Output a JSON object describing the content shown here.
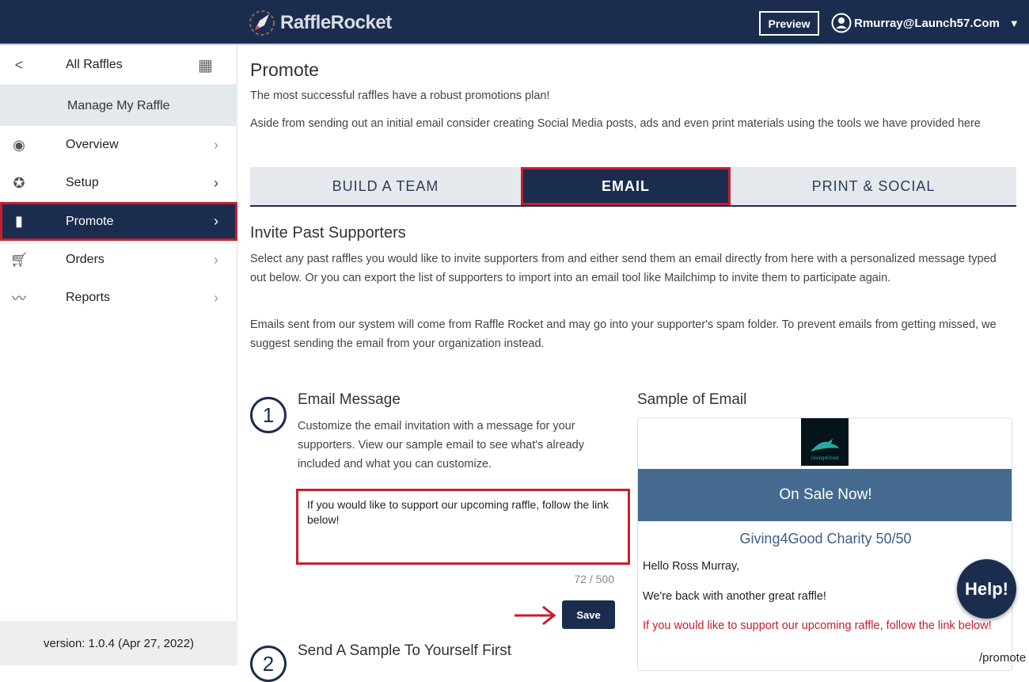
{
  "header": {
    "logo": "RaffleRocket",
    "preview_label": "Preview",
    "user_email": "Rmurray@Launch57.Com"
  },
  "sidebar": {
    "back_label": "All Raffles",
    "section": "Manage My Raffle",
    "items": [
      {
        "label": "Overview",
        "icon": "eye-icon"
      },
      {
        "label": "Setup",
        "icon": "lifebuoy-icon"
      },
      {
        "label": "Promote",
        "icon": "bar-chart-icon",
        "active": true
      },
      {
        "label": "Orders",
        "icon": "cart-icon"
      },
      {
        "label": "Reports",
        "icon": "trend-icon"
      }
    ],
    "version": "version: 1.0.4 (Apr 27, 2022)"
  },
  "page": {
    "title": "Promote",
    "intro1": "The most successful raffles have a robust promotions plan!",
    "intro2": "Aside from sending out an initial email consider creating Social Media posts, ads and even print materials using the tools we have provided here",
    "tabs": [
      "BUILD A TEAM",
      "EMAIL",
      "PRINT & SOCIAL"
    ],
    "active_tab": "EMAIL",
    "section_title": "Invite Past Supporters",
    "section_p1": "Select any past raffles you would like to invite supporters from and either send them an email directly from here with a personalized message typed out below. Or you can export the list of supporters to import into an email tool like Mailchimp to invite them to participate again.",
    "section_p2": "Emails sent from our system will come from Raffle Rocket and may go into your supporter's spam folder. To prevent emails from getting missed, we suggest sending the email from your organization instead.",
    "step1": {
      "number": "1",
      "title": "Email Message",
      "desc": "Customize the email invitation with a message for your supporters. View our sample email to see what's already included and what you can customize.",
      "message": "If you would like to support our upcoming raffle, follow the link below!",
      "count": "72 / 500",
      "save_label": "Save"
    },
    "step2": {
      "number": "2",
      "title": "Send A Sample To Yourself First"
    },
    "sample": {
      "heading": "Sample of Email",
      "logo_text": "Giving4Good",
      "banner": "On Sale Now!",
      "raffle_name": "Giving4Good Charity 50/50",
      "greeting": "Hello Ross Murray,",
      "line1": "We're back with another great raffle!",
      "custom": "If you would like to support our upcoming raffle, follow the link below!"
    }
  },
  "help_label": "Help!",
  "route": "/promote",
  "colors": {
    "navy": "#1b2d4f",
    "highlight": "#c4202f",
    "banner": "#456a8f"
  }
}
